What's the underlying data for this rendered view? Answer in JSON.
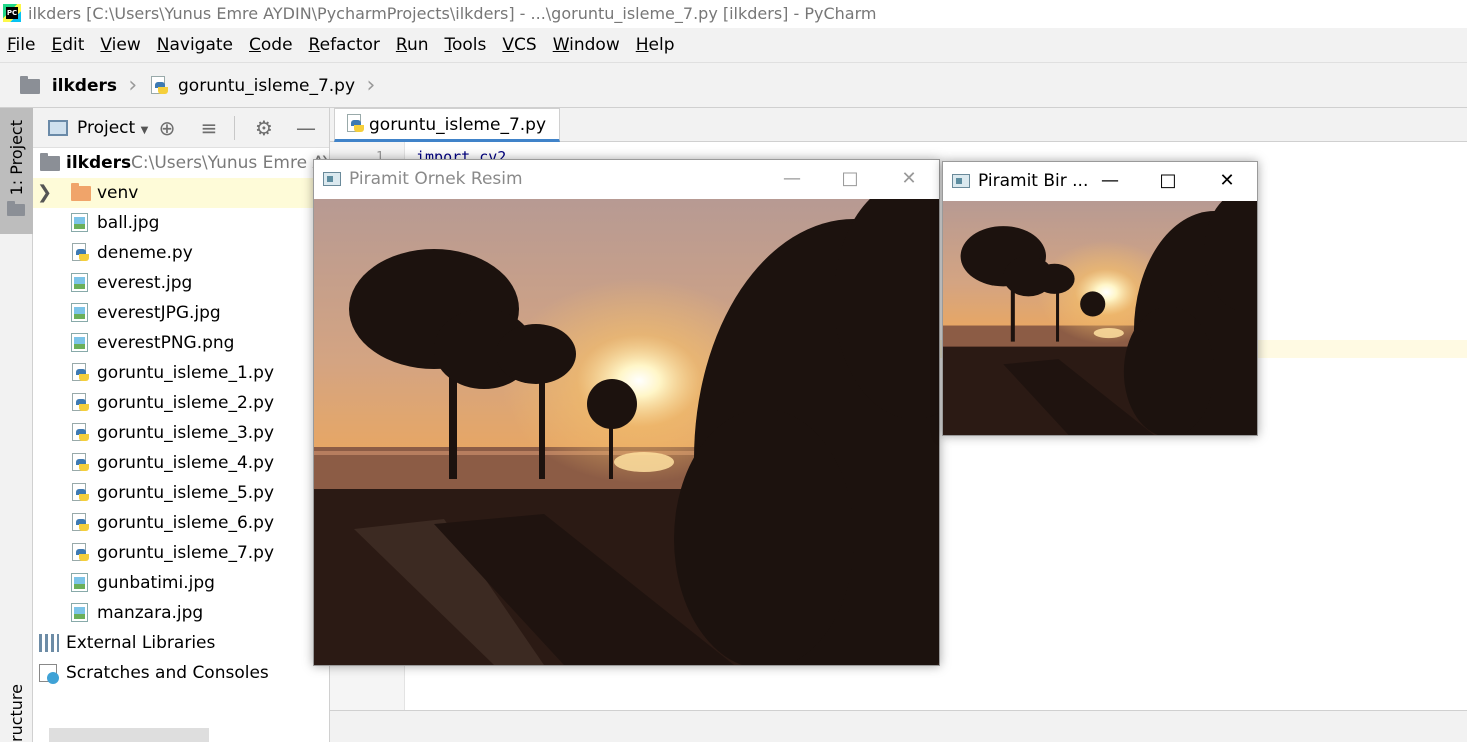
{
  "window": {
    "title": "ilkders [C:\\Users\\Yunus Emre AYDIN\\PycharmProjects\\ilkders] - ...\\goruntu_isleme_7.py [ilkders] - PyCharm"
  },
  "menu": [
    {
      "mnemonic": "F",
      "rest": "ile"
    },
    {
      "mnemonic": "E",
      "rest": "dit"
    },
    {
      "mnemonic": "V",
      "rest": "iew"
    },
    {
      "mnemonic": "N",
      "rest": "avigate"
    },
    {
      "mnemonic": "C",
      "rest": "ode"
    },
    {
      "mnemonic": "R",
      "rest": "efactor"
    },
    {
      "mnemonic": "R",
      "rest": "un"
    },
    {
      "mnemonic": "T",
      "rest": "ools"
    },
    {
      "mnemonic": "V",
      "rest": "CS"
    },
    {
      "mnemonic": "W",
      "rest": "indow"
    },
    {
      "mnemonic": "H",
      "rest": "elp"
    }
  ],
  "breadcrumb": {
    "project": "ilkders",
    "file": "goruntu_isleme_7.py"
  },
  "left_strip": {
    "project_tab": "1: Project",
    "structure_tab": "ructure"
  },
  "project_panel": {
    "view_label": "Project",
    "root": {
      "name": "ilkders",
      "path": "C:\\Users\\Yunus Emre AY"
    },
    "items": [
      {
        "name": "venv",
        "type": "folder"
      },
      {
        "name": "ball.jpg",
        "type": "image"
      },
      {
        "name": "deneme.py",
        "type": "python"
      },
      {
        "name": "everest.jpg",
        "type": "image"
      },
      {
        "name": "everestJPG.jpg",
        "type": "image"
      },
      {
        "name": "everestPNG.png",
        "type": "image"
      },
      {
        "name": "goruntu_isleme_1.py",
        "type": "python"
      },
      {
        "name": "goruntu_isleme_2.py",
        "type": "python"
      },
      {
        "name": "goruntu_isleme_3.py",
        "type": "python"
      },
      {
        "name": "goruntu_isleme_4.py",
        "type": "python"
      },
      {
        "name": "goruntu_isleme_5.py",
        "type": "python"
      },
      {
        "name": "goruntu_isleme_6.py",
        "type": "python"
      },
      {
        "name": "goruntu_isleme_7.py",
        "type": "python"
      },
      {
        "name": "gunbatimi.jpg",
        "type": "image"
      },
      {
        "name": "manzara.jpg",
        "type": "image"
      }
    ],
    "external_libraries": "External Libraries",
    "scratches": "Scratches and Consoles"
  },
  "editor": {
    "tab_label": "goruntu_isleme_7.py",
    "line_number": "1",
    "first_line": "import cv2"
  },
  "cv_windows": [
    {
      "title": "Piramit Ornek Resim",
      "active": false
    },
    {
      "title": "Piramit Bir ...",
      "active": true
    }
  ],
  "colors": {
    "accent": "#4083c9",
    "selection": "#fefbd8"
  }
}
